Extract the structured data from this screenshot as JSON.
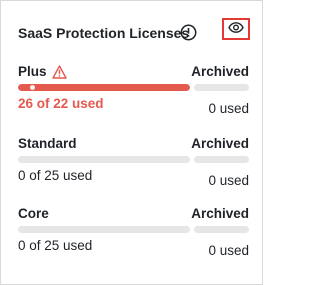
{
  "card": {
    "title": "SaaS Protection Licenses",
    "icons": {
      "info": "info-circle-icon",
      "visibility": "eye-icon",
      "warning": "warning-triangle-icon"
    },
    "colors": {
      "accent_red": "#e45a4f",
      "highlight_border": "#e53935",
      "track": "#e6e6e6",
      "text": "#1f2328"
    }
  },
  "licenses": [
    {
      "name": "Plus",
      "used_text": "26 of 22 used",
      "used": 26,
      "total": 22,
      "over_limit": true,
      "archived_label": "Archived",
      "archived_count": "0 used",
      "fill_fraction": 1.0
    },
    {
      "name": "Standard",
      "used_text": "0 of 25 used",
      "used": 0,
      "total": 25,
      "over_limit": false,
      "archived_label": "Archived",
      "archived_count": "0 used",
      "fill_fraction": 0.0
    },
    {
      "name": "Core",
      "used_text": "0 of 25 used",
      "used": 0,
      "total": 25,
      "over_limit": false,
      "archived_label": "Archived",
      "archived_count": "0 used",
      "fill_fraction": 0.0
    }
  ]
}
